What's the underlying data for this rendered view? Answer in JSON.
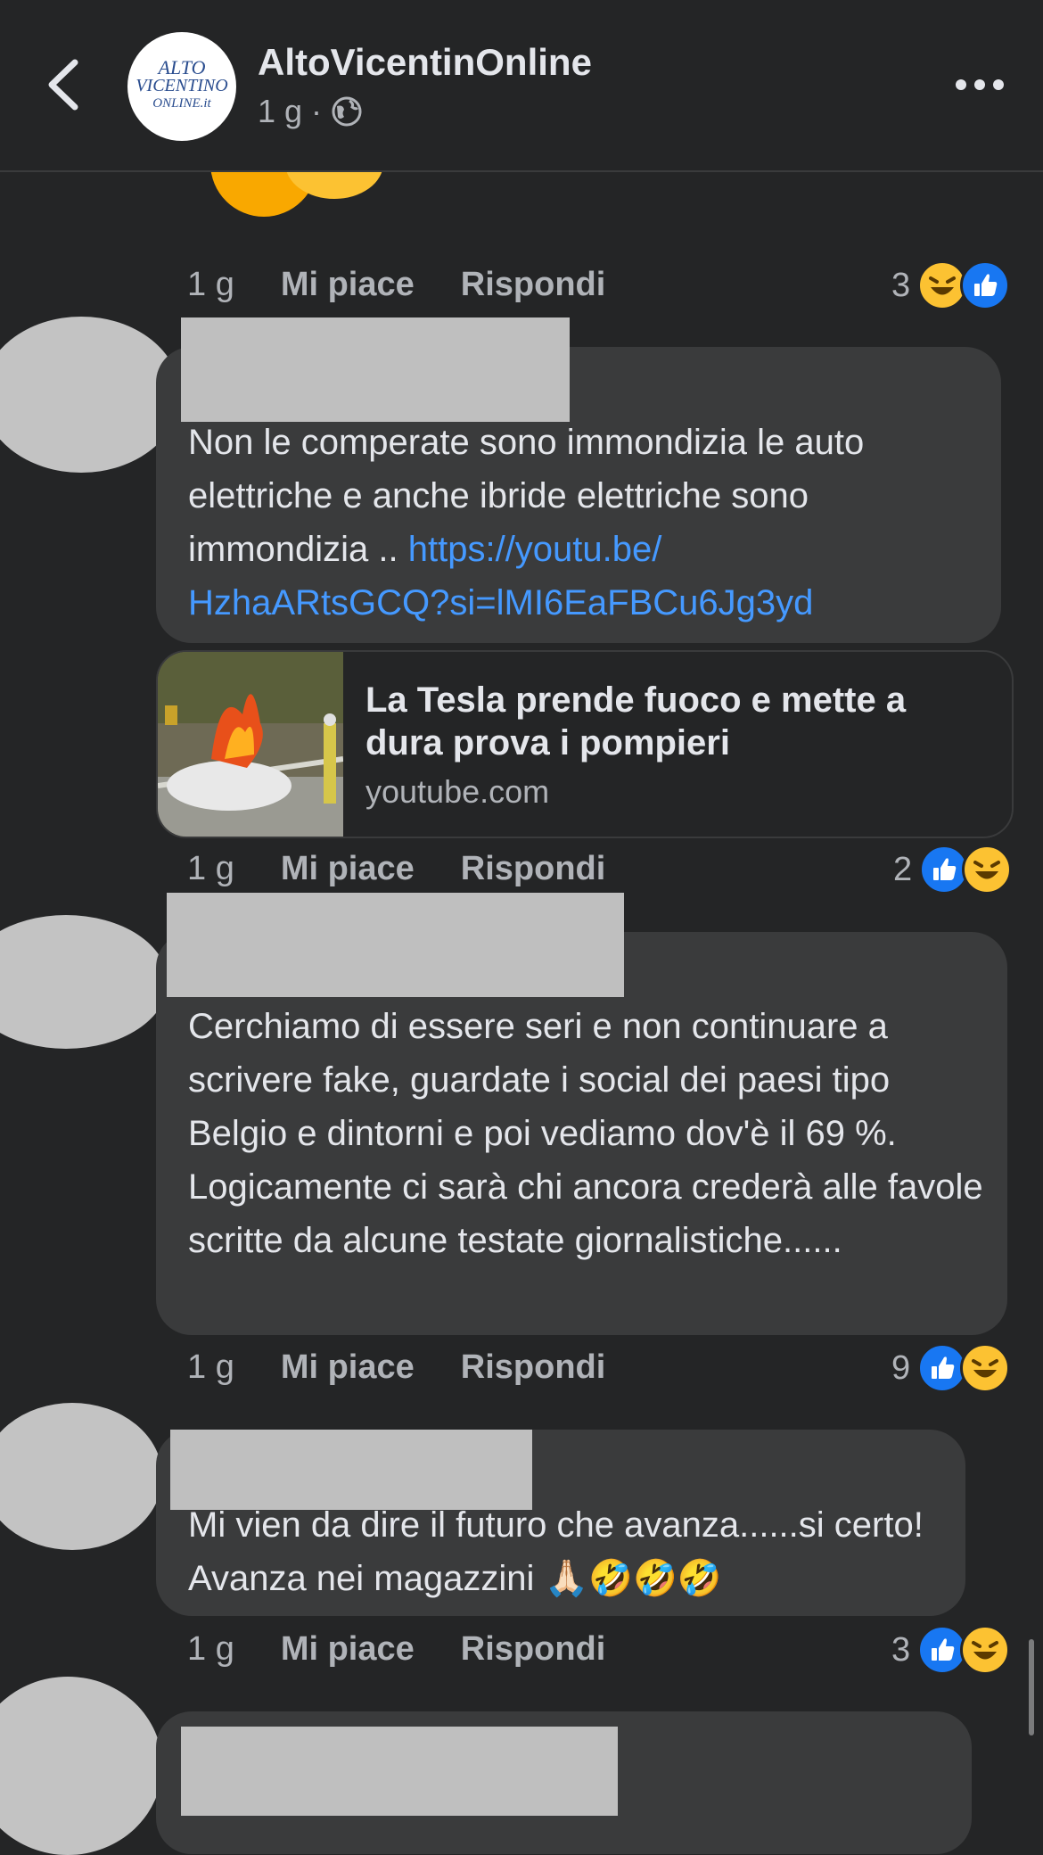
{
  "header": {
    "page_name": "AltoVicentinOnline",
    "meta_time": "1 g ·",
    "logo_line1": "ALTO",
    "logo_line2": "VICENTINO",
    "logo_line3": "ONLINE.it",
    "back_icon": "chevron-left-icon",
    "more_icon": "more-dots-icon",
    "privacy_icon": "globe-icon"
  },
  "colors": {
    "background": "#242526",
    "bubble": "#3a3b3c",
    "link": "#4599ff",
    "like": "#1877f2",
    "haha": "#fcc232"
  },
  "top_comment": {
    "time": "1 g",
    "like": "Mi piace",
    "reply": "Rispondi",
    "reaction_count": "3",
    "reactions": [
      "haha",
      "like"
    ]
  },
  "comments": [
    {
      "text_plain": "Non le comperate sono immondizia le auto elettriche e anche ibride elettriche sono immondizia .. ",
      "link": "https://youtu.be/HzhaARtsGCQ?si=lMI6EaFBCu6Jg3yd",
      "link_line1": "https://youtu.be/",
      "link_line2": "HzhaARtsGCQ?si=lMI6EaFBCu6Jg3yd",
      "preview": {
        "title": "La Tesla prende fuoco e mette a dura prova i pompieri",
        "domain": "youtube.com"
      },
      "time": "1 g",
      "like": "Mi piace",
      "reply": "Rispondi",
      "reaction_count": "2",
      "reactions": [
        "like",
        "haha"
      ]
    },
    {
      "text": "Cerchiamo di essere seri e non continuare a scrivere fake, guardate i social dei paesi tipo Belgio e dintorni e poi vediamo dov'è il 69 %. Logicamente ci sarà chi ancora crederà alle favole scritte da alcune testate giornalistiche......",
      "time": "1 g",
      "like": "Mi piace",
      "reply": "Rispondi",
      "reaction_count": "9",
      "reactions": [
        "like",
        "haha"
      ]
    },
    {
      "text": "Mi vien da dire il futuro che avanza......si certo! Avanza nei magazzini 🙏🏻🤣🤣🤣",
      "time": "1 g",
      "like": "Mi piace",
      "reply": "Rispondi",
      "reaction_count": "3",
      "reactions": [
        "like",
        "haha"
      ]
    }
  ]
}
